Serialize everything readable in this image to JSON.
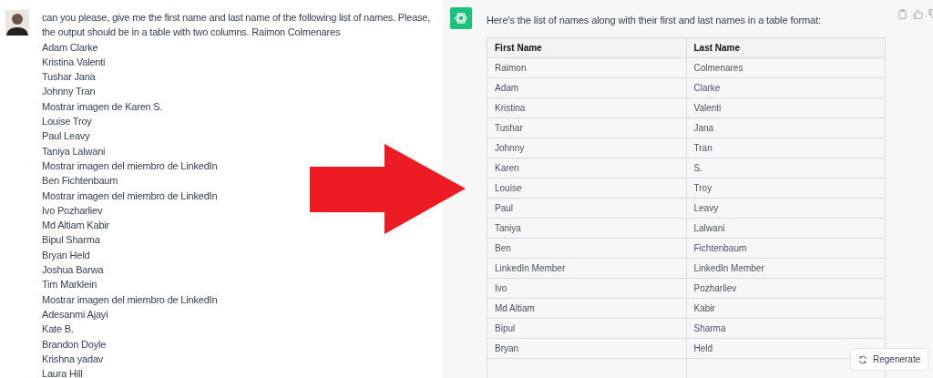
{
  "user_message": {
    "prompt": "can you please, give me the first name and last name of the following list of names. Please, the output should be in a table with two columns. Raimon Colmenares",
    "names": [
      "Adam Clarke",
      "Kristina Valenti",
      "Tushar Jana",
      "Johnny Tran",
      "Mostrar imagen de Karen S.",
      "Louise Troy",
      "Paul Leavy",
      "Taniya Lalwani",
      "Mostrar imagen del miembro de LinkedIn",
      "Ben Fichtenbaum",
      "Mostrar imagen del miembro de LinkedIn",
      "Ivo Pozharliev",
      "Md Altiam Kabir",
      "Bipul Sharma",
      "Bryan Held",
      "Joshua Barwa",
      "Tim Marklein",
      "Mostrar imagen del miembro de LinkedIn",
      "Adesanmi Ajayi",
      "Kate B.",
      "Brandon Doyle",
      "Krishna yadav",
      "Laura Hill"
    ]
  },
  "assistant_message": {
    "intro": "Here's the list of names along with their first and last names in a table format:",
    "table": {
      "columns": [
        "First Name",
        "Last Name"
      ],
      "rows": [
        [
          "Raimon",
          "Colmenares"
        ],
        [
          "Adam",
          "Clarke"
        ],
        [
          "Kristina",
          "Valenti"
        ],
        [
          "Tushar",
          "Jana"
        ],
        [
          "Johnny",
          "Tran"
        ],
        [
          "Karen",
          "S."
        ],
        [
          "Louise",
          "Troy"
        ],
        [
          "Paul",
          "Leavy"
        ],
        [
          "Taniya",
          "Lalwani"
        ],
        [
          "Ben",
          "Fichtenbaum"
        ],
        [
          "LinkedIn Member",
          "LinkedIn Member"
        ],
        [
          "Ivo",
          "Pozharliev"
        ],
        [
          "Md Altiam",
          "Kabir"
        ],
        [
          "Bipul",
          "Sharma"
        ],
        [
          "Bryan",
          "Held"
        ]
      ]
    }
  },
  "regenerate_button": {
    "label": "Regenerate"
  }
}
